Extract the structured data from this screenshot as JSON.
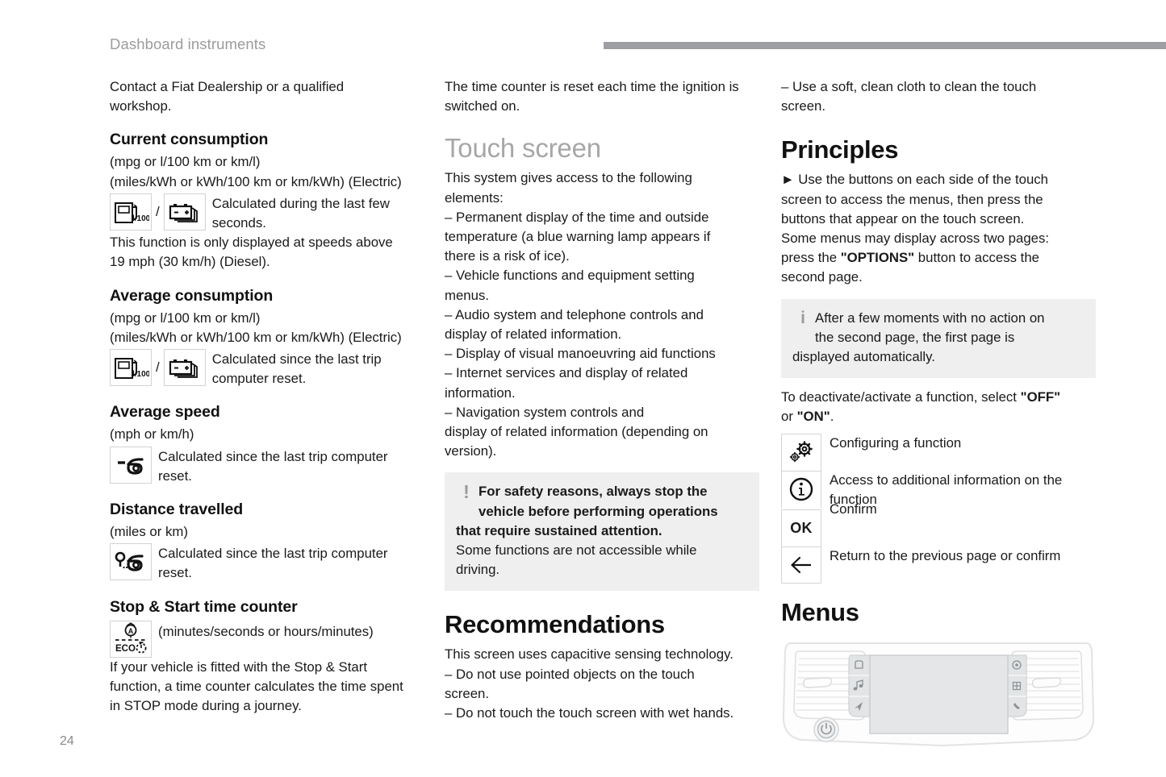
{
  "header": {
    "title": "Dashboard instruments",
    "rule_color": "#9d9fa2"
  },
  "page_number": "24",
  "col1": {
    "intro": [
      "Contact a Fiat Dealership or a qualified",
      "workshop."
    ],
    "current_consumption": {
      "heading": "Current consumption",
      "units_1": "(mpg or l/100 km or km/l)",
      "units_2": "(miles/kWh or kWh/100 km or km/kWh) (Electric)",
      "icon_fuel_label": "l/100",
      "separator": "/",
      "desc_line1": "Calculated during the last few",
      "desc_line2": "seconds.",
      "note_line1": "This function is only displayed at speeds above",
      "note_line2": "19 mph (30 km/h) (Diesel)."
    },
    "average_consumption": {
      "heading": "Average consumption",
      "units_1": "(mpg or l/100 km or km/l)",
      "units_2": "(miles/kWh or kWh/100 km or km/kWh) (Electric)",
      "icon_fuel_label": "l/100",
      "separator": "/",
      "desc_line1": "Calculated since the last trip",
      "desc_line2": "computer reset."
    },
    "average_speed": {
      "heading": "Average speed",
      "units": "(mph or km/h)",
      "desc_line1": "Calculated since the last trip computer",
      "desc_line2": "reset."
    },
    "distance_travelled": {
      "heading": "Distance travelled",
      "units": "(miles or km)",
      "desc_line1": "Calculated since the last trip computer",
      "desc_line2": "reset."
    },
    "stop_start": {
      "heading": "Stop & Start time counter",
      "icon_eco_label": "ECO",
      "units": "(minutes/seconds or hours/minutes)",
      "body_line1": "If your vehicle is fitted with the Stop & Start",
      "body_line2": "function, a time counter calculates the time spent",
      "body_line3": "in STOP mode during a journey."
    }
  },
  "col2": {
    "intro_line1": "The time counter is reset each time the ignition is",
    "intro_line2": "switched on.",
    "touch_screen_heading": "Touch screen",
    "intro2_line1": "This system gives access to the following",
    "intro2_line2": "elements:",
    "bullets": [
      "–  Permanent display of the time and outside",
      "temperature (a blue warning lamp appears if",
      "there is a risk of ice).",
      "–  Vehicle functions and equipment setting",
      "menus.",
      "–  Audio system and telephone controls and",
      "display of related information.",
      "–  Display of visual manoeuvring aid functions",
      "–  Internet services and display of related",
      "information.",
      "–  Navigation system controls and",
      "display of related information (depending on",
      "version)."
    ],
    "warning_box": {
      "icon": "exclamation-icon",
      "bold_line1": "For safety reasons, always stop the",
      "bold_line2": "vehicle before performing operations",
      "bold_line3": "that require sustained attention.",
      "normal_line1": "Some functions are not accessible while",
      "normal_line2": "driving."
    },
    "recommendations": {
      "heading": "Recommendations",
      "lines": [
        "This screen uses capacitive sensing technology.",
        "–  Do not use pointed objects on the touch",
        "screen.",
        "–  Do not touch the touch screen with wet hands."
      ]
    }
  },
  "col3": {
    "top_lines": [
      "–  Use a soft, clean cloth to clean the touch",
      "screen."
    ],
    "principles": {
      "heading": "Principles",
      "arrow": "►",
      "line1": "Use the buttons on each side of the touch",
      "line2": "screen to access the menus, then press the",
      "line3": "buttons that appear on the touch screen.",
      "line4": "Some menus may display across two pages:",
      "line5_a": "press the ",
      "line5_b": "\"OPTIONS\"",
      "line5_c": " button to access the",
      "line6": "second page."
    },
    "info_box": {
      "icon": "info-icon",
      "line1": "After a few moments with no action on",
      "line2": "the second page, the first page is",
      "line3": "displayed automatically."
    },
    "toggle_line_a": "To deactivate/activate a function, select ",
    "toggle_line_off": "\"OFF\"",
    "toggle_line_b": "or ",
    "toggle_line_on": "\"ON\"",
    "toggle_line_c": ".",
    "symbols": [
      {
        "icon": "gears-icon",
        "label": "Configuring a function"
      },
      {
        "icon": "info-circle-icon",
        "label_line1": "Access to additional information on the",
        "label_line2": "function"
      },
      {
        "icon": "ok-text-icon",
        "text": "OK",
        "label": "Confirm"
      },
      {
        "icon": "left-arrow-icon",
        "label": "Return to the previous page or confirm"
      }
    ],
    "menus": {
      "heading": "Menus",
      "illustration": {
        "name": "dashboard-console-illustration",
        "buttons_left": [
          "home-icon",
          "music-note-icon",
          "navigation-icon"
        ],
        "buttons_right": [
          "settings-dial-icon",
          "apps-grid-icon",
          "phone-icon"
        ],
        "knob": "power-knob-icon",
        "screen": "touch-screen-display"
      }
    }
  }
}
